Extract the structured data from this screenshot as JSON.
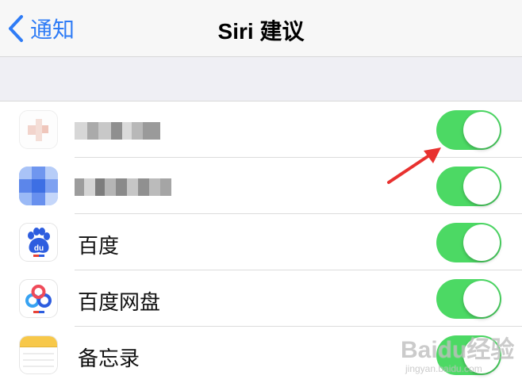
{
  "nav": {
    "back_label": "通知",
    "title": "Siri 建议"
  },
  "apps": [
    {
      "label": "",
      "icon": "blurred-app-icon",
      "toggle_on": true
    },
    {
      "label": "",
      "icon": "blurred-app-icon",
      "toggle_on": true
    },
    {
      "label": "百度",
      "icon": "baidu-paw-icon",
      "toggle_on": true
    },
    {
      "label": "百度网盘",
      "icon": "baidu-netdisk-icon",
      "toggle_on": true
    },
    {
      "label": "备忘录",
      "icon": "notes-icon",
      "toggle_on": true
    }
  ],
  "watermark": {
    "main": "Baidu经验",
    "sub": "jingyan.baidu.com"
  },
  "colors": {
    "accent": "#2f7cf6",
    "toggle_on": "#4cd964",
    "annotation_arrow": "#e8312f"
  }
}
